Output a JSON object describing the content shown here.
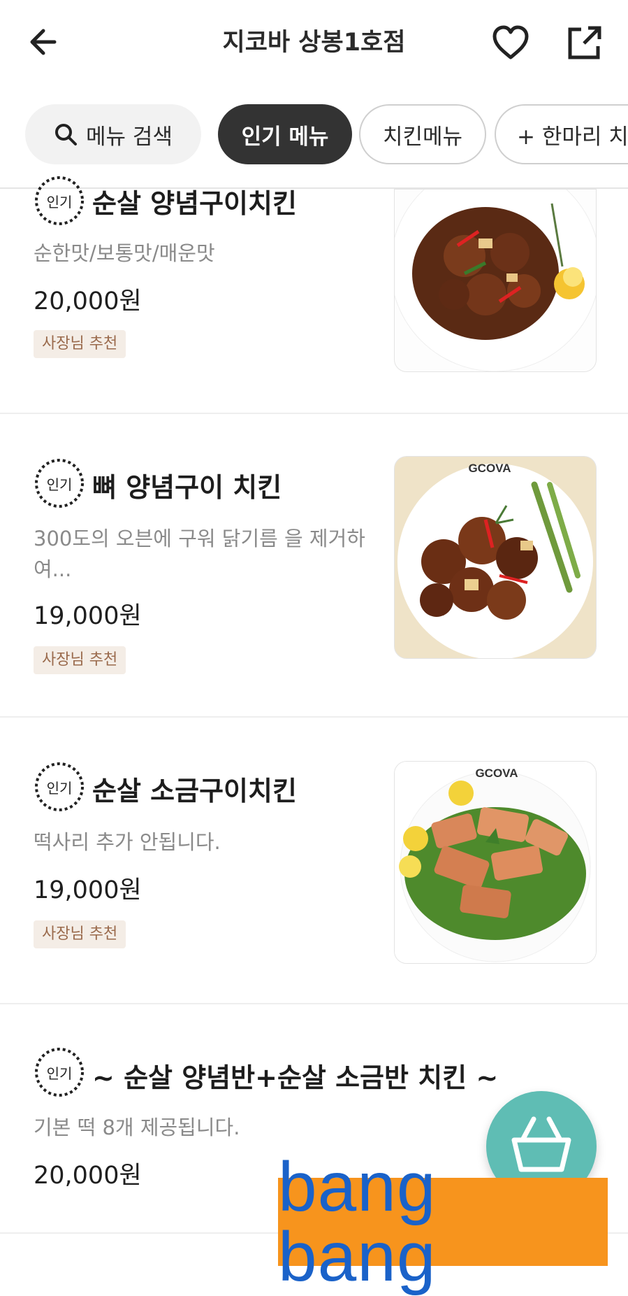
{
  "header": {
    "title": "지코바 상봉1호점",
    "back_icon": "arrow-left-icon",
    "favorite_icon": "heart-icon",
    "share_icon": "share-icon"
  },
  "chips": [
    {
      "label": "메뉴 검색",
      "icon": "search-icon"
    },
    {
      "label": "인기 메뉴",
      "active": true
    },
    {
      "label": "치킨메뉴"
    },
    {
      "label": "+ 한마리 치"
    }
  ],
  "badge_label": "인기",
  "items": [
    {
      "name": "순살 양념구이치킨",
      "desc": "순한맛/보통맛/매운맛",
      "price": "20,000원",
      "tag": "사장님 추천",
      "image": "boneless-yangnyeom-chicken"
    },
    {
      "name": "뼈 양념구이 치킨",
      "desc": "300도의 오븐에 구워 닭기름 을 제거하여...",
      "price": "19,000원",
      "tag": "사장님 추천",
      "image": "bone-in-yangnyeom-chicken",
      "image_text": "GCOVA"
    },
    {
      "name": "순살 소금구이치킨",
      "desc": "떡사리 추가 안됩니다.",
      "price": "19,000원",
      "tag": "사장님 추천",
      "image": "boneless-salt-chicken",
      "image_text": "GCOVA"
    },
    {
      "name": "~ 순살 양념반+순살 소금반 치킨 ~",
      "desc": "기본 떡 8개 제공됩니다.",
      "price": "20,000원"
    }
  ],
  "cart_icon": "shopping-basket-icon",
  "overlay_text": "bang bang",
  "colors": {
    "accent": "#5fbdb4",
    "active_chip": "#333333",
    "tag_bg": "#f4ede6",
    "tag_text": "#9a6a4c",
    "overlay_bg": "#f7941d",
    "overlay_text": "#1a62c9"
  }
}
